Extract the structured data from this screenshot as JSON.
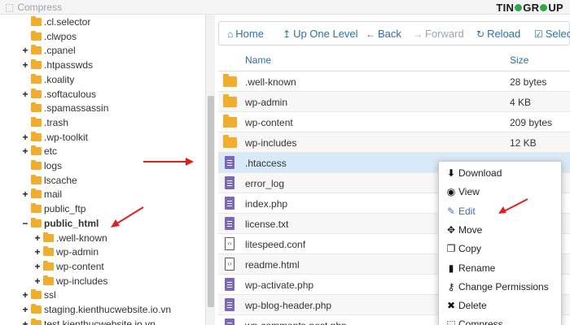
{
  "app": {
    "title": "Compress",
    "brand_left": "TIN",
    "brand_right": "GR",
    "brand_end": "UP"
  },
  "tree": {
    "items": [
      {
        "label": ".cl.selector",
        "toggle": "",
        "indent": 1
      },
      {
        "label": ".clwpos",
        "toggle": "",
        "indent": 1
      },
      {
        "label": ".cpanel",
        "toggle": "+",
        "indent": 1
      },
      {
        "label": ".htpasswds",
        "toggle": "+",
        "indent": 1
      },
      {
        "label": ".koality",
        "toggle": "",
        "indent": 1
      },
      {
        "label": ".softaculous",
        "toggle": "+",
        "indent": 1
      },
      {
        "label": ".spamassassin",
        "toggle": "",
        "indent": 1
      },
      {
        "label": ".trash",
        "toggle": "",
        "indent": 1
      },
      {
        "label": ".wp-toolkit",
        "toggle": "+",
        "indent": 1
      },
      {
        "label": "etc",
        "toggle": "+",
        "indent": 1
      },
      {
        "label": "logs",
        "toggle": "",
        "indent": 1
      },
      {
        "label": "lscache",
        "toggle": "",
        "indent": 1
      },
      {
        "label": "mail",
        "toggle": "+",
        "indent": 1
      },
      {
        "label": "public_ftp",
        "toggle": "",
        "indent": 1
      },
      {
        "label": "public_html",
        "toggle": "−",
        "indent": 1,
        "bold": true
      },
      {
        "label": ".well-known",
        "toggle": "+",
        "indent": 2
      },
      {
        "label": "wp-admin",
        "toggle": "+",
        "indent": 2
      },
      {
        "label": "wp-content",
        "toggle": "+",
        "indent": 2
      },
      {
        "label": "wp-includes",
        "toggle": "+",
        "indent": 2
      },
      {
        "label": "ssl",
        "toggle": "+",
        "indent": 1
      },
      {
        "label": "staging.kienthucwebsite.io.vn",
        "toggle": "+",
        "indent": 1
      },
      {
        "label": "test.kienthucwebsite.io.vn",
        "toggle": "+",
        "indent": 1
      }
    ]
  },
  "toolbar": {
    "home": "Home",
    "up": "Up One Level",
    "back": "Back",
    "forward": "Forward",
    "reload": "Reload",
    "select": "Select"
  },
  "table": {
    "col_name": "Name",
    "col_size": "Size",
    "rows": [
      {
        "name": ".well-known",
        "size": "28 bytes",
        "type": "folder"
      },
      {
        "name": "wp-admin",
        "size": "4 KB",
        "type": "folder"
      },
      {
        "name": "wp-content",
        "size": "209 bytes",
        "type": "folder"
      },
      {
        "name": "wp-includes",
        "size": "12 KB",
        "type": "folder"
      },
      {
        "name": ".htaccess",
        "size": "",
        "type": "doc",
        "selected": true
      },
      {
        "name": "error_log",
        "size": "",
        "type": "doc"
      },
      {
        "name": "index.php",
        "size": "",
        "type": "doc"
      },
      {
        "name": "license.txt",
        "size": "",
        "type": "doc"
      },
      {
        "name": "litespeed.conf",
        "size": "",
        "type": "code"
      },
      {
        "name": "readme.html",
        "size": "",
        "type": "html"
      },
      {
        "name": "wp-activate.php",
        "size": "",
        "type": "doc"
      },
      {
        "name": "wp-blog-header.php",
        "size": "",
        "type": "doc"
      },
      {
        "name": "wp-comments-post.php",
        "size": "",
        "type": "doc"
      }
    ]
  },
  "context_menu": {
    "items": [
      {
        "label": "Download",
        "icon": "download-icon",
        "glyph": "⬇"
      },
      {
        "label": "View",
        "icon": "eye-icon",
        "glyph": "◉"
      },
      {
        "label": "Edit",
        "icon": "pencil-icon",
        "glyph": "✎"
      },
      {
        "label": "Move",
        "icon": "move-icon",
        "glyph": "✥"
      },
      {
        "label": "Copy",
        "icon": "copy-icon",
        "glyph": "❐"
      },
      {
        "label": "Rename",
        "icon": "file-icon",
        "glyph": "▮"
      },
      {
        "label": "Change Permissions",
        "icon": "key-icon",
        "glyph": "⚷"
      },
      {
        "label": "Delete",
        "icon": "close-icon",
        "glyph": "✖"
      },
      {
        "label": "Compress",
        "icon": "compress-icon",
        "glyph": "⬚"
      }
    ]
  },
  "colors": {
    "accent": "#2f6fa8",
    "folder": "#f0ad2e",
    "arrow": "#e02020",
    "selected_row": "#d8e9f7"
  }
}
